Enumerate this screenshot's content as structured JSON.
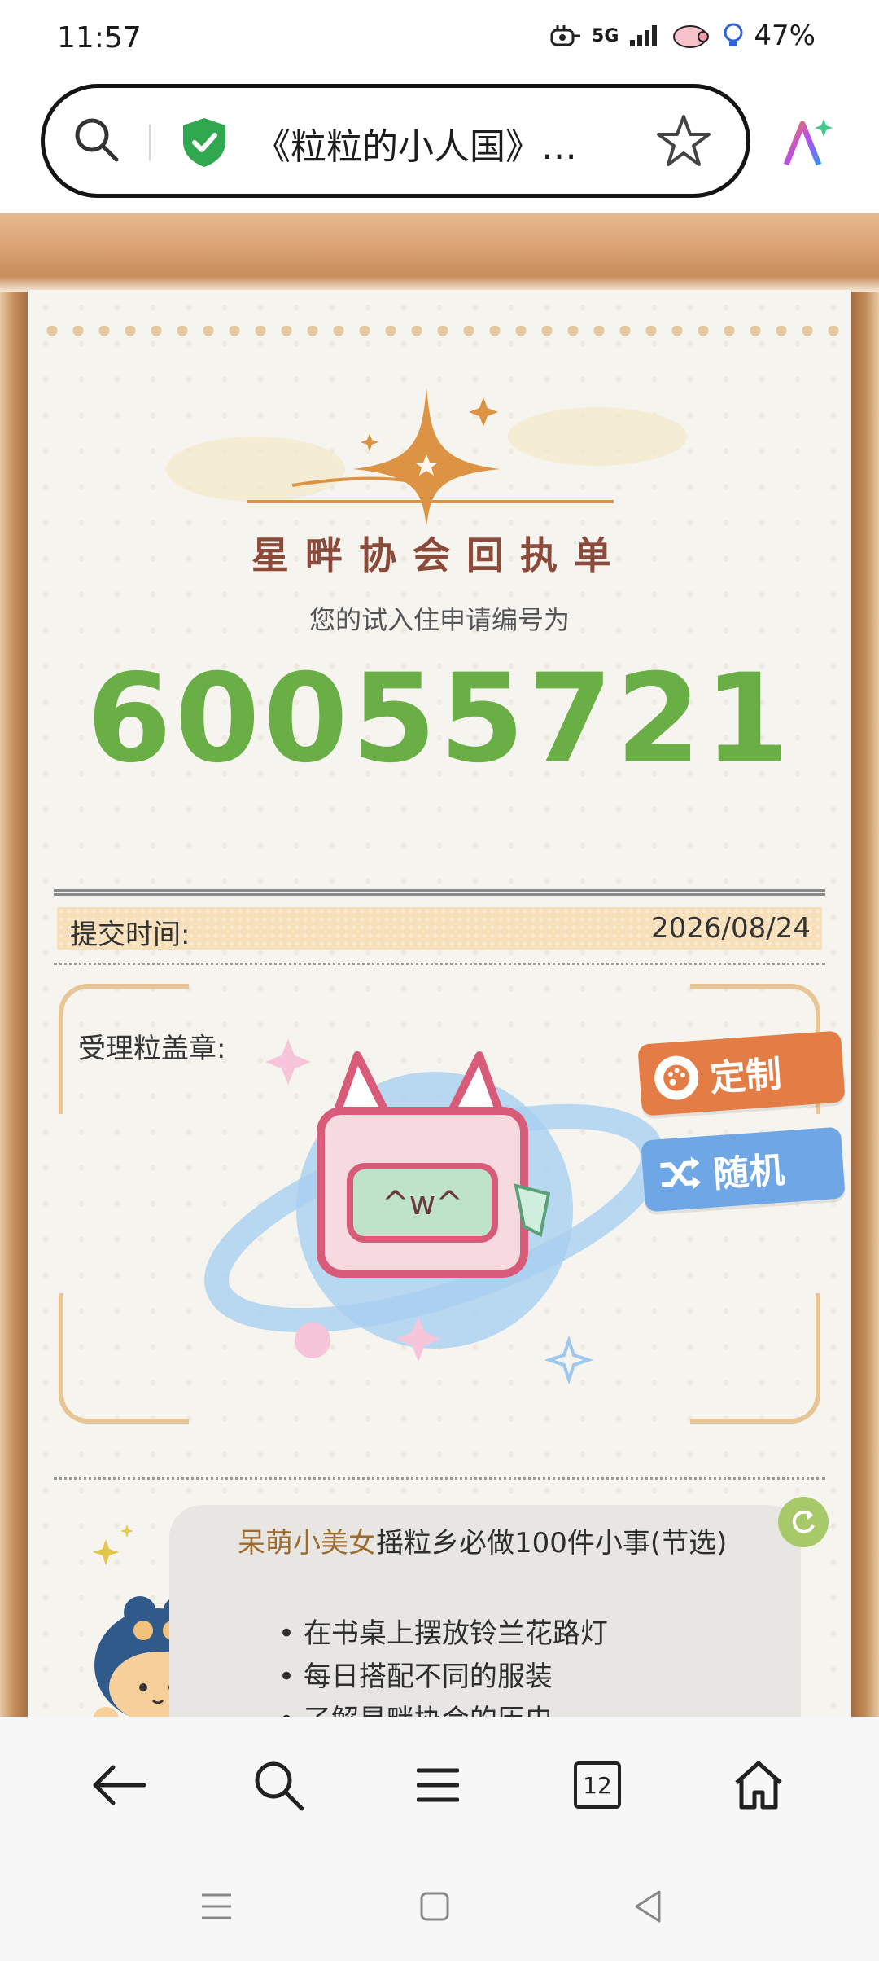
{
  "status_bar": {
    "time": "11:57",
    "network": "5G",
    "battery": "47%"
  },
  "browser": {
    "page_title": "《粒粒的小人国》…",
    "secure_icon": "shield-check-icon",
    "accent_color": "#2fa84f"
  },
  "receipt": {
    "header_title": "星畔协会回执单",
    "apply_label": "您的试入住申请编号为",
    "apply_number": "60055721",
    "number_color": "#6aae46",
    "submit_label": "提交时间:",
    "submit_date": "2026/08/24",
    "stamp_label": "受理粒盖章:",
    "stamp_text": "^w^",
    "custom_button": "定制",
    "random_button": "随机"
  },
  "todo_card": {
    "user_name": "呆萌小美女",
    "title_rest": "摇粒乡必做100件小事(节选)",
    "items": [
      "在书桌上摆放铃兰花路灯",
      "每日搭配不同的服装",
      "了解星畔协会的历史"
    ]
  },
  "toolbar": {
    "tab_count": "12",
    "icons": [
      "back-icon",
      "search-icon",
      "menu-icon",
      "tabs-icon",
      "home-icon"
    ]
  },
  "navbar": {
    "icons": [
      "recents-icon",
      "home-square-icon",
      "back-triangle-icon"
    ]
  }
}
